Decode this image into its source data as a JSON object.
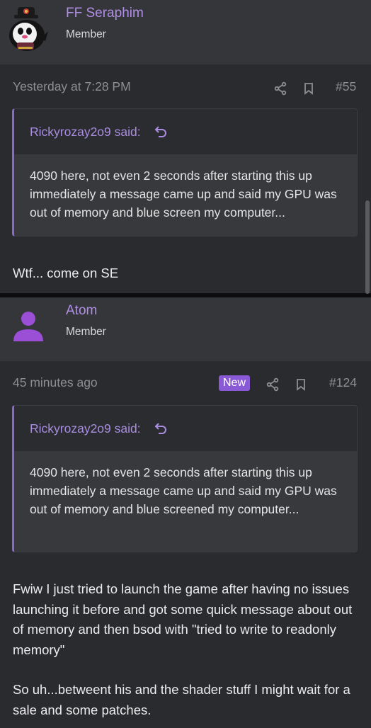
{
  "posts": [
    {
      "username": "FF Seraphim",
      "user_title": "Member",
      "avatar_icon": "penguin-avatar-icon",
      "timestamp": "Yesterday at 7:28 PM",
      "post_number": "#55",
      "is_new": false,
      "quote": {
        "author_line": "Rickyrozay2o9 said:",
        "text": "4090 here, not even 2 seconds after starting this up immediately a message came up and said my GPU was out of memory and blue screen my computer..."
      },
      "message": [
        "Wtf... come on SE"
      ]
    },
    {
      "username": "Atom",
      "user_title": "Member",
      "avatar_icon": "default-user-avatar-icon",
      "timestamp": "45 minutes ago",
      "new_badge": "New",
      "post_number": "#124",
      "is_new": true,
      "quote": {
        "author_line": "Rickyrozay2o9 said:",
        "text": "4090 here, not even 2 seconds after starting this up immediately a message came up and said my GPU was out of memory and blue screened my computer..."
      },
      "message": [
        "Fwiw I just tried to launch the game after having no issues launching it before and got some quick message about out of memory and then bsod with \"tried to write to readonly memory\"",
        "So uh...betweent his and the shader stuff I might wait for a sale and some patches."
      ]
    }
  ],
  "icons": {
    "share": "share-icon",
    "bookmark": "bookmark-icon",
    "quote_jump": "jump-to-quote-icon"
  },
  "colors": {
    "background": "#2a2b2f",
    "header_background": "#35363a",
    "accent_purple": "#b08fe6",
    "badge_purple": "#8a5ad6",
    "muted_text": "#8e8f93"
  }
}
